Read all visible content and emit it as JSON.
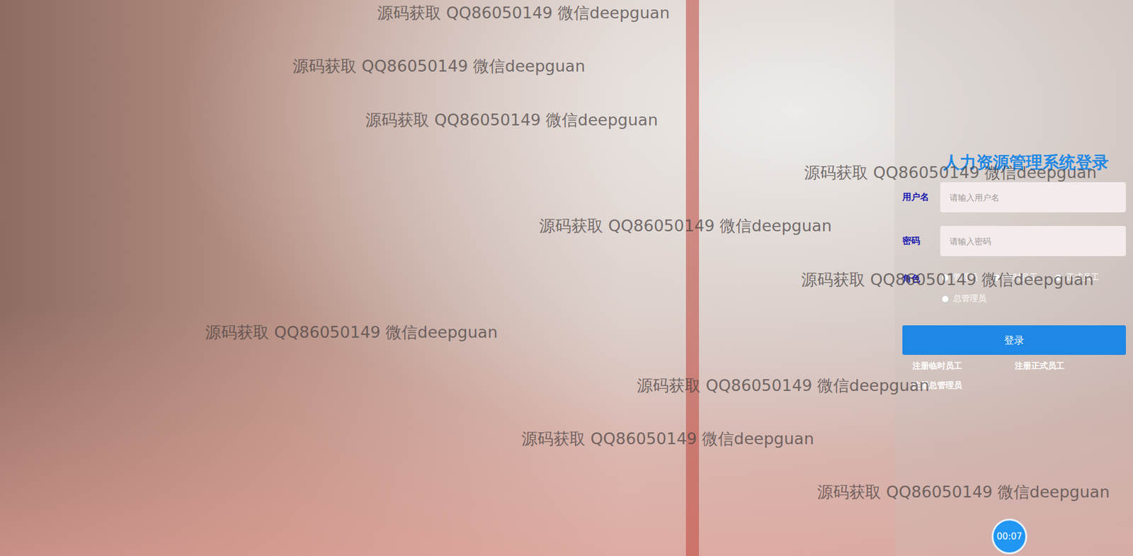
{
  "title": "人力资源管理系统登录",
  "fields": [
    {
      "label": "用户名",
      "placeholder": "请输入用户名",
      "type": "text"
    },
    {
      "label": "密码",
      "placeholder": "请输入密码",
      "type": "password"
    }
  ],
  "role": {
    "label": "角色",
    "options": [
      {
        "label": "管理员",
        "selected": false
      },
      {
        "label": "临时员工",
        "selected": false
      },
      {
        "label": "正式员工",
        "selected": false
      },
      {
        "label": "总管理员",
        "selected": false
      }
    ]
  },
  "login_button": "登录",
  "links": [
    "注册临时员工",
    "注册正式员工",
    "注册总管理员"
  ],
  "timer": "00:07",
  "watermarks": [
    "源码获取 QQ86050149 微信deepguan",
    "源码获取 QQ86050149 微信deepguan",
    "源码获取 QQ86050149 微信deepguan",
    "源码获取 QQ86050149 微信deepguan",
    "源码获取 QQ86050149 微信deepguan",
    "源码获取 QQ86050149 微信deepguan",
    "源码获取 QQ86050149 微信deepguan",
    "源码获取 QQ86050149 微信deepguan",
    "源码获取 QQ86050149 微信deepguan",
    "源码获取 QQ86050149 微信deepguan"
  ]
}
